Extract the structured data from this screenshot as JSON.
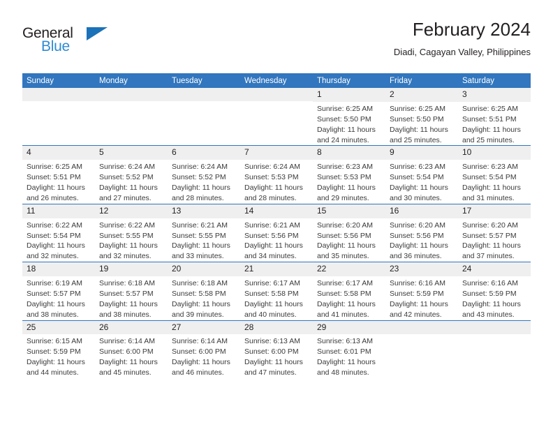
{
  "brand": {
    "name_part1": "General",
    "name_part2": "Blue",
    "triangle_color": "#1b72b8",
    "blue_text_color": "#2e8bd4"
  },
  "header": {
    "title": "February 2024",
    "subtitle": "Diadi, Cagayan Valley, Philippines"
  },
  "theme": {
    "header_blue": "#3176be",
    "daynum_band": "#efefef",
    "text": "#231f20"
  },
  "weekdays": [
    "Sunday",
    "Monday",
    "Tuesday",
    "Wednesday",
    "Thursday",
    "Friday",
    "Saturday"
  ],
  "weeks": [
    [
      {
        "day": "",
        "empty": true
      },
      {
        "day": "",
        "empty": true
      },
      {
        "day": "",
        "empty": true
      },
      {
        "day": "",
        "empty": true
      },
      {
        "day": "1",
        "sunrise": "Sunrise: 6:25 AM",
        "sunset": "Sunset: 5:50 PM",
        "daylight": "Daylight: 11 hours and 24 minutes."
      },
      {
        "day": "2",
        "sunrise": "Sunrise: 6:25 AM",
        "sunset": "Sunset: 5:50 PM",
        "daylight": "Daylight: 11 hours and 25 minutes."
      },
      {
        "day": "3",
        "sunrise": "Sunrise: 6:25 AM",
        "sunset": "Sunset: 5:51 PM",
        "daylight": "Daylight: 11 hours and 25 minutes."
      }
    ],
    [
      {
        "day": "4",
        "sunrise": "Sunrise: 6:25 AM",
        "sunset": "Sunset: 5:51 PM",
        "daylight": "Daylight: 11 hours and 26 minutes."
      },
      {
        "day": "5",
        "sunrise": "Sunrise: 6:24 AM",
        "sunset": "Sunset: 5:52 PM",
        "daylight": "Daylight: 11 hours and 27 minutes."
      },
      {
        "day": "6",
        "sunrise": "Sunrise: 6:24 AM",
        "sunset": "Sunset: 5:52 PM",
        "daylight": "Daylight: 11 hours and 28 minutes."
      },
      {
        "day": "7",
        "sunrise": "Sunrise: 6:24 AM",
        "sunset": "Sunset: 5:53 PM",
        "daylight": "Daylight: 11 hours and 28 minutes."
      },
      {
        "day": "8",
        "sunrise": "Sunrise: 6:23 AM",
        "sunset": "Sunset: 5:53 PM",
        "daylight": "Daylight: 11 hours and 29 minutes."
      },
      {
        "day": "9",
        "sunrise": "Sunrise: 6:23 AM",
        "sunset": "Sunset: 5:54 PM",
        "daylight": "Daylight: 11 hours and 30 minutes."
      },
      {
        "day": "10",
        "sunrise": "Sunrise: 6:23 AM",
        "sunset": "Sunset: 5:54 PM",
        "daylight": "Daylight: 11 hours and 31 minutes."
      }
    ],
    [
      {
        "day": "11",
        "sunrise": "Sunrise: 6:22 AM",
        "sunset": "Sunset: 5:54 PM",
        "daylight": "Daylight: 11 hours and 32 minutes."
      },
      {
        "day": "12",
        "sunrise": "Sunrise: 6:22 AM",
        "sunset": "Sunset: 5:55 PM",
        "daylight": "Daylight: 11 hours and 32 minutes."
      },
      {
        "day": "13",
        "sunrise": "Sunrise: 6:21 AM",
        "sunset": "Sunset: 5:55 PM",
        "daylight": "Daylight: 11 hours and 33 minutes."
      },
      {
        "day": "14",
        "sunrise": "Sunrise: 6:21 AM",
        "sunset": "Sunset: 5:56 PM",
        "daylight": "Daylight: 11 hours and 34 minutes."
      },
      {
        "day": "15",
        "sunrise": "Sunrise: 6:20 AM",
        "sunset": "Sunset: 5:56 PM",
        "daylight": "Daylight: 11 hours and 35 minutes."
      },
      {
        "day": "16",
        "sunrise": "Sunrise: 6:20 AM",
        "sunset": "Sunset: 5:56 PM",
        "daylight": "Daylight: 11 hours and 36 minutes."
      },
      {
        "day": "17",
        "sunrise": "Sunrise: 6:20 AM",
        "sunset": "Sunset: 5:57 PM",
        "daylight": "Daylight: 11 hours and 37 minutes."
      }
    ],
    [
      {
        "day": "18",
        "sunrise": "Sunrise: 6:19 AM",
        "sunset": "Sunset: 5:57 PM",
        "daylight": "Daylight: 11 hours and 38 minutes."
      },
      {
        "day": "19",
        "sunrise": "Sunrise: 6:18 AM",
        "sunset": "Sunset: 5:57 PM",
        "daylight": "Daylight: 11 hours and 38 minutes."
      },
      {
        "day": "20",
        "sunrise": "Sunrise: 6:18 AM",
        "sunset": "Sunset: 5:58 PM",
        "daylight": "Daylight: 11 hours and 39 minutes."
      },
      {
        "day": "21",
        "sunrise": "Sunrise: 6:17 AM",
        "sunset": "Sunset: 5:58 PM",
        "daylight": "Daylight: 11 hours and 40 minutes."
      },
      {
        "day": "22",
        "sunrise": "Sunrise: 6:17 AM",
        "sunset": "Sunset: 5:58 PM",
        "daylight": "Daylight: 11 hours and 41 minutes."
      },
      {
        "day": "23",
        "sunrise": "Sunrise: 6:16 AM",
        "sunset": "Sunset: 5:59 PM",
        "daylight": "Daylight: 11 hours and 42 minutes."
      },
      {
        "day": "24",
        "sunrise": "Sunrise: 6:16 AM",
        "sunset": "Sunset: 5:59 PM",
        "daylight": "Daylight: 11 hours and 43 minutes."
      }
    ],
    [
      {
        "day": "25",
        "sunrise": "Sunrise: 6:15 AM",
        "sunset": "Sunset: 5:59 PM",
        "daylight": "Daylight: 11 hours and 44 minutes."
      },
      {
        "day": "26",
        "sunrise": "Sunrise: 6:14 AM",
        "sunset": "Sunset: 6:00 PM",
        "daylight": "Daylight: 11 hours and 45 minutes."
      },
      {
        "day": "27",
        "sunrise": "Sunrise: 6:14 AM",
        "sunset": "Sunset: 6:00 PM",
        "daylight": "Daylight: 11 hours and 46 minutes."
      },
      {
        "day": "28",
        "sunrise": "Sunrise: 6:13 AM",
        "sunset": "Sunset: 6:00 PM",
        "daylight": "Daylight: 11 hours and 47 minutes."
      },
      {
        "day": "29",
        "sunrise": "Sunrise: 6:13 AM",
        "sunset": "Sunset: 6:01 PM",
        "daylight": "Daylight: 11 hours and 48 minutes."
      },
      {
        "day": "",
        "empty": true
      },
      {
        "day": "",
        "empty": true
      }
    ]
  ]
}
